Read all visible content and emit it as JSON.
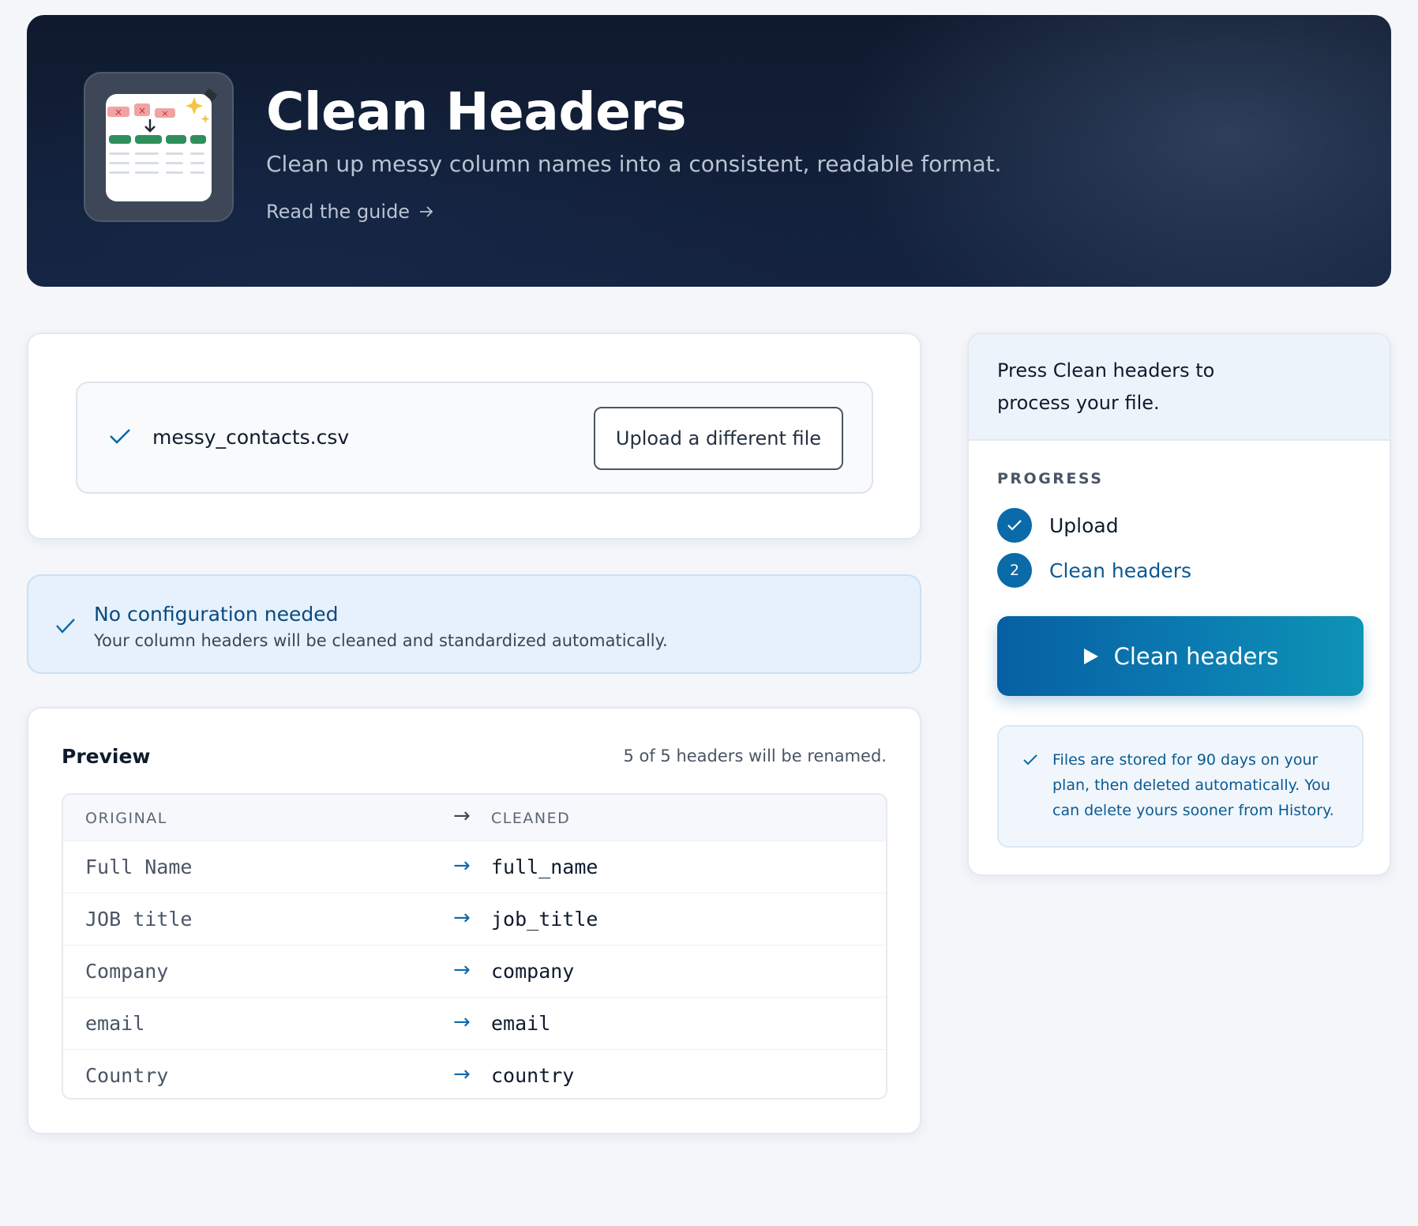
{
  "hero": {
    "title": "Clean Headers",
    "subtitle": "Clean up messy column names into a consistent, readable format.",
    "guide_link": "Read the guide",
    "guide_icon": "arrow-right-icon",
    "app_icon": "spreadsheet-clean-icon"
  },
  "upload": {
    "file_name": "messy_contacts.csv",
    "status_icon": "check-icon",
    "change_button": "Upload a different file"
  },
  "config_notice": {
    "title": "No configuration needed",
    "description": "Your column headers will be cleaned and standardized automatically."
  },
  "preview": {
    "title": "Preview",
    "summary": "5 of 5 headers will be renamed.",
    "columns": {
      "original": "ORIGINAL",
      "arrow": "→",
      "cleaned": "CLEANED"
    },
    "rows": [
      {
        "original": "Full Name",
        "arrow": "→",
        "cleaned": "full_name"
      },
      {
        "original": "JOB title",
        "arrow": "→",
        "cleaned": "job_title"
      },
      {
        "original": "Company",
        "arrow": "→",
        "cleaned": "company"
      },
      {
        "original": "email",
        "arrow": "→",
        "cleaned": "email"
      },
      {
        "original": "Country",
        "arrow": "→",
        "cleaned": "country"
      }
    ]
  },
  "sidebar": {
    "instruction": "Press Clean headers to process your file.",
    "progress_label": "PROGRESS",
    "steps": [
      {
        "marker": "check-icon",
        "label": "Upload",
        "state": "done"
      },
      {
        "marker": "2",
        "label": "Clean headers",
        "state": "current"
      }
    ],
    "run_button": "Clean headers",
    "run_icon": "play-icon",
    "retention_note": "Files are stored for 90 days on your plan, then deleted automatically. You can delete yours sooner from History."
  },
  "colors": {
    "accent": "#0b6aa8",
    "hero_bg": "#0f1a2e",
    "info_bg": "#e6f1fb"
  }
}
